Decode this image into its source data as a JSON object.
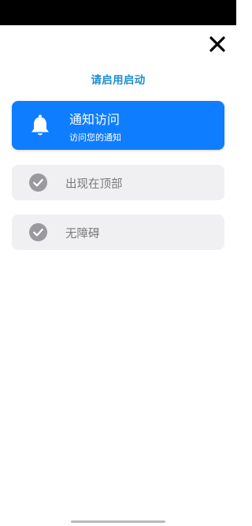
{
  "header": {
    "title": "请启用启动",
    "close_icon": "close-icon"
  },
  "permissions": [
    {
      "title": "通知访问",
      "subtitle": "访问您的通知",
      "icon": "bell-icon",
      "state": "active"
    },
    {
      "title": "出现在顶部",
      "icon": "check-circle-icon",
      "state": "inactive"
    },
    {
      "title": "无障碍",
      "icon": "check-circle-icon",
      "state": "inactive"
    }
  ],
  "colors": {
    "accent": "#0f7dff",
    "title": "#1f8fd0",
    "card_inactive": "#f0f0f2",
    "text_inactive": "#7a7a7e",
    "check_circle": "#9a9a9e"
  }
}
